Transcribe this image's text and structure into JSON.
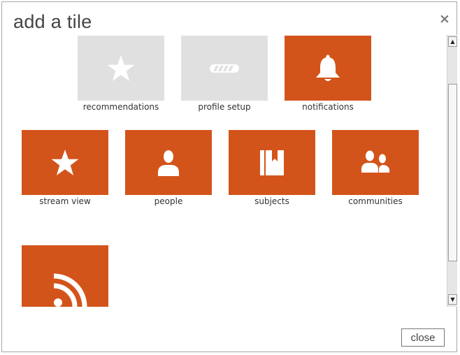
{
  "dialog": {
    "title": "add a tile",
    "close_x": "×",
    "close_button_label": "close"
  },
  "colors": {
    "tile_active": "#d3541b",
    "tile_disabled": "#e0e0e0",
    "icon_active": "#ffffff"
  },
  "tiles": [
    {
      "label": "recommendations",
      "icon": "star-icon",
      "state": "disabled"
    },
    {
      "label": "profile setup",
      "icon": "progress-bar-icon",
      "state": "disabled"
    },
    {
      "label": "notifications",
      "icon": "bell-icon",
      "state": "active"
    },
    {
      "label": "stream view",
      "icon": "star-icon",
      "state": "active"
    },
    {
      "label": "people",
      "icon": "person-icon",
      "state": "active"
    },
    {
      "label": "subjects",
      "icon": "bookmark-book-icon",
      "state": "active"
    },
    {
      "label": "communities",
      "icon": "group-icon",
      "state": "active"
    },
    {
      "label": "",
      "icon": "rss-feed-icon",
      "state": "active"
    }
  ],
  "scrollbar": {
    "up_arrow": "▲",
    "down_arrow": "▼"
  }
}
